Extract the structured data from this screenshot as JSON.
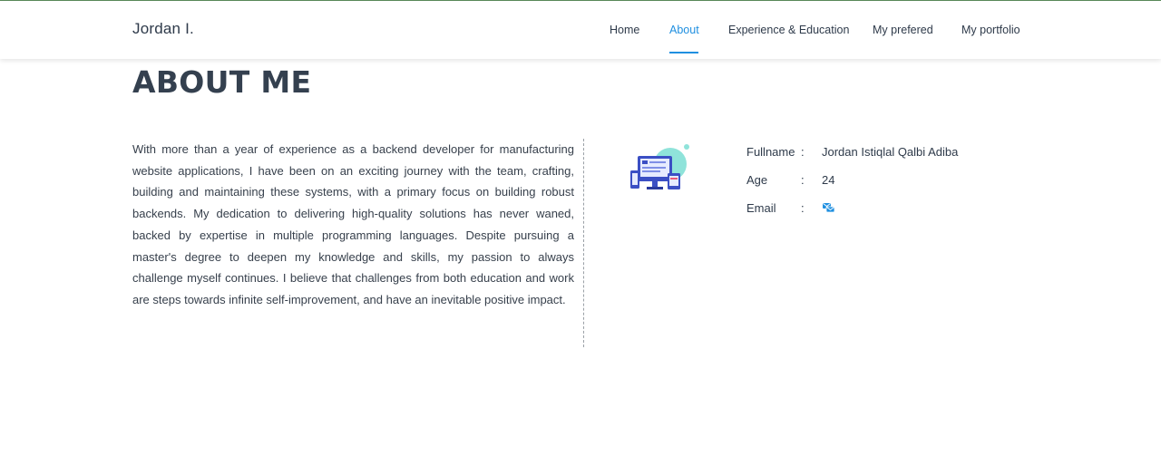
{
  "brand": "Jordan I.",
  "nav": [
    {
      "label": "Home",
      "active": false
    },
    {
      "label": "About",
      "active": true
    },
    {
      "label": "Experience & Education",
      "active": false
    },
    {
      "label": "My prefered",
      "active": false
    },
    {
      "label": "My portfolio",
      "active": false
    }
  ],
  "colors": {
    "accent": "#1f8fe0",
    "text": "#2e3a4a",
    "title": "#34404f"
  },
  "page_title": "ABOUT ME",
  "about_text": "With more than a year of experience as a backend developer for manufacturing website applications, I have been on an exciting journey with the team, crafting, building and maintaining these systems, with a primary focus on building robust backends. My dedication to delivering high-quality solutions has never waned, backed by expertise in multiple programming languages. Despite pursuing a master's degree to deepen my knowledge and skills, my passion to always challenge myself continues. I believe that challenges from both education and work are steps towards infinite self-improvement, and have an inevitable positive impact.",
  "illustration_icon": "devices-illustration",
  "info": {
    "separator": ":",
    "fullname_label": "Fullname",
    "fullname_value": "Jordan Istiqlal Qalbi Adiba",
    "age_label": "Age",
    "age_value": "24",
    "email_label": "Email",
    "email_icon": "email-link-icon"
  }
}
